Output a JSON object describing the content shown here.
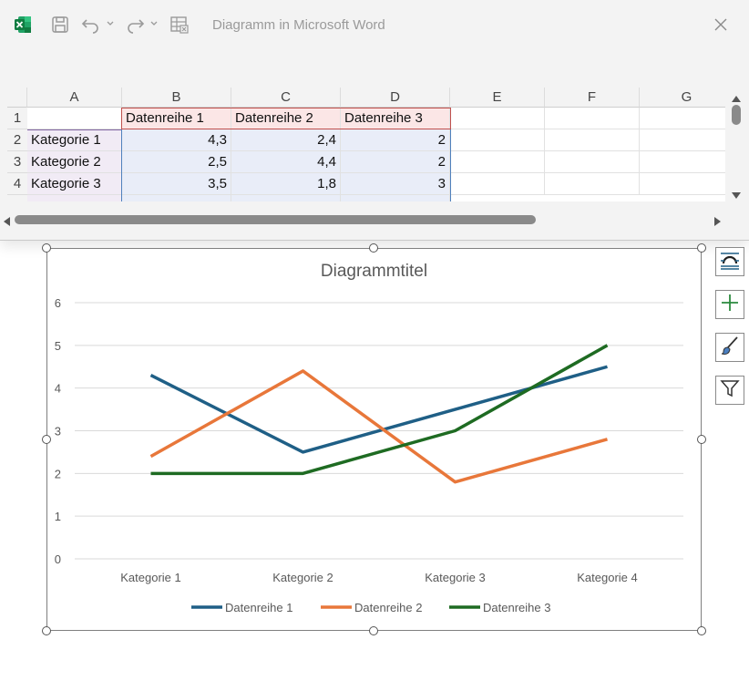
{
  "window": {
    "title": "Diagramm in Microsoft Word"
  },
  "toolbar": {
    "icons": [
      "excel-icon",
      "save-icon",
      "undo-icon",
      "redo-icon",
      "edit-data-icon",
      "close-icon"
    ]
  },
  "sheet": {
    "columns": [
      "A",
      "B",
      "C",
      "D",
      "E",
      "F",
      "G"
    ],
    "rows": [
      "1",
      "2",
      "3",
      "4"
    ],
    "header_row": [
      "",
      "Datenreihe 1",
      "Datenreihe 2",
      "Datenreihe 3"
    ],
    "data_rows": [
      [
        "Kategorie 1",
        "4,3",
        "2,4",
        "2"
      ],
      [
        "Kategorie 2",
        "2,5",
        "4,4",
        "2"
      ],
      [
        "Kategorie 3",
        "3,5",
        "1,8",
        "3"
      ]
    ]
  },
  "colors": {
    "series1": "#1f5f86",
    "series2": "#e8773a",
    "series3": "#1e6b22",
    "grid": "#d9d9d9",
    "axis_text": "#595959"
  },
  "chart_data": {
    "type": "line",
    "title": "Diagrammtitel",
    "categories": [
      "Kategorie 1",
      "Kategorie 2",
      "Kategorie 3",
      "Kategorie 4"
    ],
    "series": [
      {
        "name": "Datenreihe 1",
        "values": [
          4.3,
          2.5,
          3.5,
          4.5
        ]
      },
      {
        "name": "Datenreihe 2",
        "values": [
          2.4,
          4.4,
          1.8,
          2.8
        ]
      },
      {
        "name": "Datenreihe 3",
        "values": [
          2,
          2,
          3,
          5
        ]
      }
    ],
    "ylim": [
      0,
      6
    ],
    "yticks": [
      "0",
      "1",
      "2",
      "3",
      "4",
      "5",
      "6"
    ],
    "grid": true,
    "legend": "bottom"
  },
  "side_buttons": [
    "chart-elements-icon-layout",
    "add-element-icon",
    "brush-icon",
    "filter-icon"
  ]
}
